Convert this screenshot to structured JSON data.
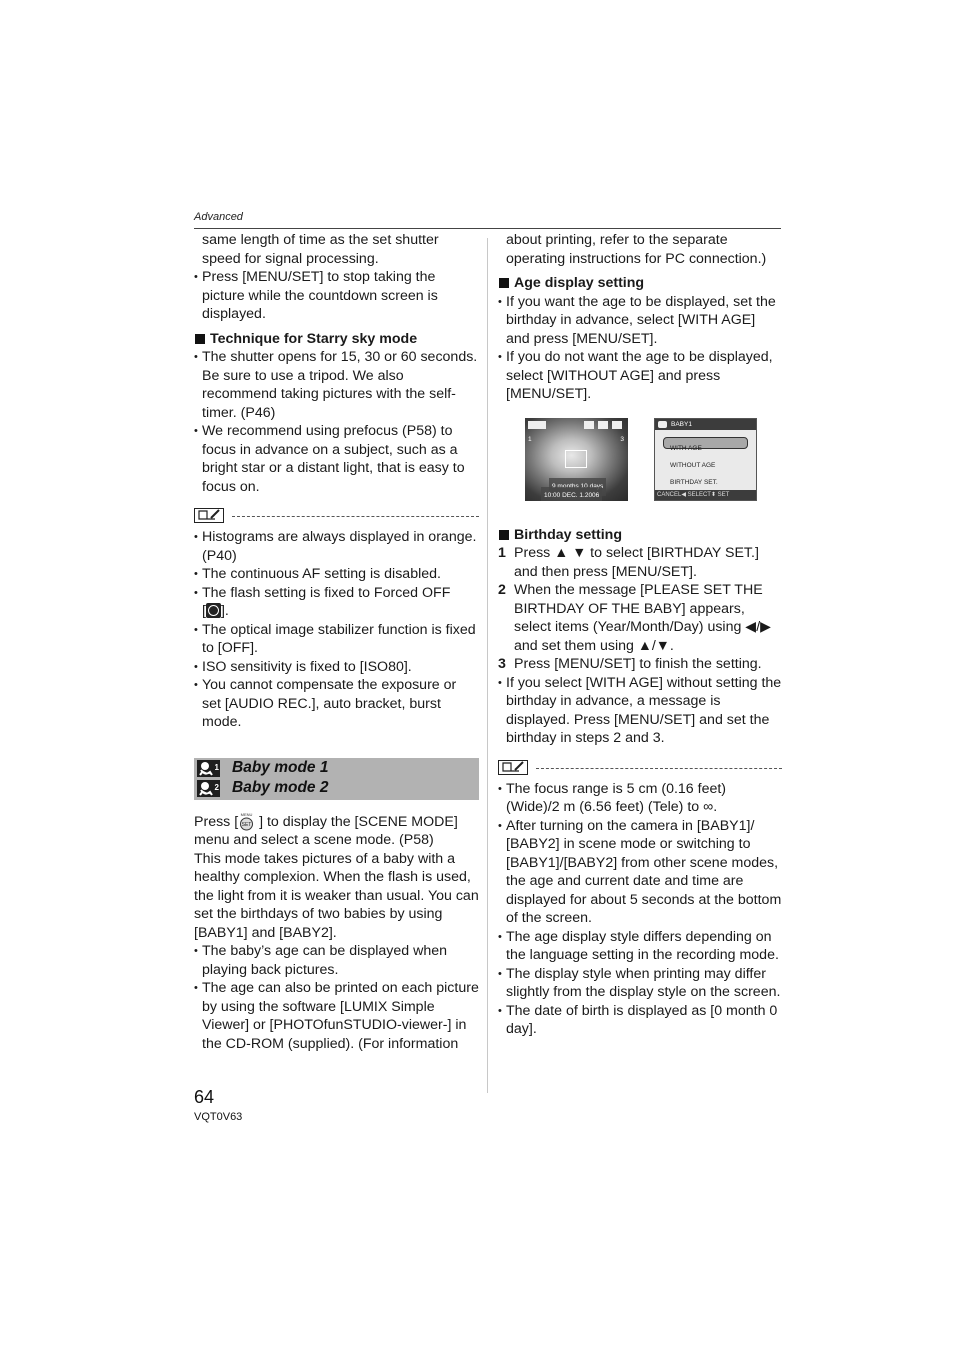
{
  "header": {
    "section": "Advanced"
  },
  "left": {
    "intro_lines": [
      "same length of time as the set shutter",
      "speed for signal processing."
    ],
    "bullet_countdown": "Press [MENU/SET] to stop taking the picture while the countdown screen is displayed.",
    "starry_heading": "Technique for Starry sky mode",
    "starry_bullets": [
      "The shutter opens for 15, 30 or 60 seconds. Be sure to use a tripod. We also recommend taking pictures with the self-timer. (P46)",
      "We recommend using prefocus (P58) to focus in advance on a subject, such as a bright star or a distant light, that is easy to focus on."
    ],
    "notes": [
      "Histograms are always displayed in orange. (P40)",
      "The continuous AF setting is disabled.",
      "The flash setting is fixed to Forced OFF",
      "The optical image stabilizer function is fixed to [OFF].",
      "ISO sensitivity is fixed to [ISO80].",
      "You cannot compensate the exposure or set [AUDIO REC.], auto bracket, burst mode."
    ],
    "flash_suffix_open": "[",
    "flash_suffix_close": "].",
    "banner": {
      "mode1": "Baby mode 1",
      "mode2": "Baby mode 2",
      "sup1": "1",
      "sup2": "2"
    },
    "press_prefix": "Press [",
    "press_suffix": "] to display the [SCENE MODE] menu and select a scene mode. (P58)",
    "description": "This mode takes pictures of a baby with a healthy complexion. When the flash is used, the light from it is weaker than usual. You can set the birthdays of two babies by using [BABY1] and [BABY2].",
    "baby_bullets": [
      "The baby’s age can be displayed when playing back pictures.",
      "The age can also be printed on each picture by using the software [LUMIX Simple Viewer] or [PHOTOfunSTUDIO-viewer-] in the CD-ROM (supplied). (For information"
    ]
  },
  "right": {
    "continuation": "about printing, refer to the separate operating instructions for PC connection.)",
    "age_heading": "Age display setting",
    "age_bullets": [
      "If you want the age to be displayed, set the birthday in advance, select [WITH AGE] and press [MENU/SET].",
      "If you do not want the age to be displayed, select [WITHOUT AGE] and press [MENU/SET]."
    ],
    "screen1": {
      "age": "9 months 10 days",
      "datetime": "10:00  DEC. 1.2006",
      "count": "3",
      "mode": "1"
    },
    "screen2": {
      "title": "BABY1",
      "options": [
        "WITH AGE",
        "WITHOUT AGE",
        "BIRTHDAY SET."
      ],
      "selected": "WITH AGE",
      "footer": "CANCEL◀  SELECT⬍  SET"
    },
    "birthday_heading": "Birthday setting",
    "steps": [
      {
        "num": "1",
        "text": "Press ▲ ▼ to select [BIRTHDAY SET.] and then press [MENU/SET]."
      },
      {
        "num": "2",
        "text": "When the message [PLEASE SET THE BIRTHDAY OF THE BABY] appears, select items (Year/Month/Day) using ◀/▶ and set them using ▲/▼."
      },
      {
        "num": "3",
        "text": "Press [MENU/SET] to finish the setting."
      }
    ],
    "step_bullet": "If you select [WITH AGE] without setting the birthday in advance, a message is displayed. Press [MENU/SET] and set the birthday in steps 2 and 3.",
    "notes": [
      "The focus range is 5 cm (0.16 feet) (Wide)/2 m (6.56 feet) (Tele) to ∞.",
      "After turning on the camera in [BABY1]/ [BABY2] in scene mode or switching to [BABY1]/[BABY2] from other scene modes, the age and current date and time are displayed for about 5 seconds at the bottom of the screen.",
      "The age display style differs depending on the language setting in the recording mode.",
      "The display style when printing may differ slightly from the display style on the screen.",
      "The date of birth is displayed as [0 month 0 day]."
    ]
  },
  "footer": {
    "page_number": "64",
    "model_code": "VQT0V63"
  }
}
